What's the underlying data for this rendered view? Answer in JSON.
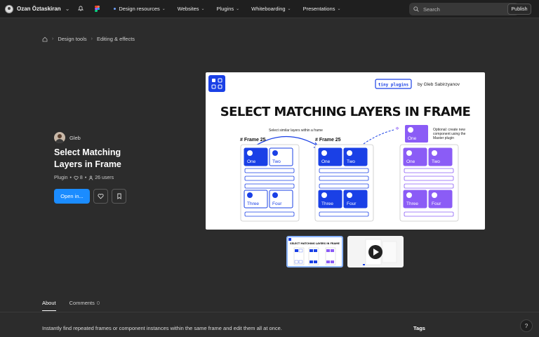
{
  "topbar": {
    "user_name": "Ozan Öztaskiran",
    "nav": [
      {
        "label": "Design resources",
        "active": true
      },
      {
        "label": "Websites"
      },
      {
        "label": "Plugins"
      },
      {
        "label": "Whiteboarding"
      },
      {
        "label": "Presentations"
      }
    ],
    "search_placeholder": "Search",
    "publish_label": "Publish"
  },
  "breadcrumb": [
    "Design tools",
    "Editing & effects"
  ],
  "plugin": {
    "author": "Gleb",
    "title": "Select Matching Layers in Frame",
    "type": "Plugin",
    "likes": "8",
    "users": "26 users",
    "open_label": "Open in..."
  },
  "hero": {
    "badge": "tiny plugins",
    "byline": "by Gleb Sabirzyanov",
    "heading": "SELECT MATCHING LAYERS IN FRAME",
    "annotation_select": "Select similar layers within a frame",
    "annotation_optional": "Optional: create new component using the Master plugin",
    "frame_label_1": "# Frame 25",
    "frame_label_2": "# Frame 25",
    "master_label": "One",
    "cards": [
      "One",
      "Two",
      "Three",
      "Four"
    ]
  },
  "thumbs": {
    "thumb1_heading": "SELECT MATCHING LAYERS IN FRAME"
  },
  "tabs": {
    "about": "About",
    "comments": "Comments",
    "comments_count": "0"
  },
  "about": {
    "description": "Instantly find repeated frames or component instances within the same frame and edit them all at once.",
    "tags_heading": "Tags"
  },
  "colors": {
    "accent": "#1b8cff",
    "card_blue": "#1a40e6",
    "card_purple": "#8b5cf6",
    "bg": "#2c2c2c"
  }
}
